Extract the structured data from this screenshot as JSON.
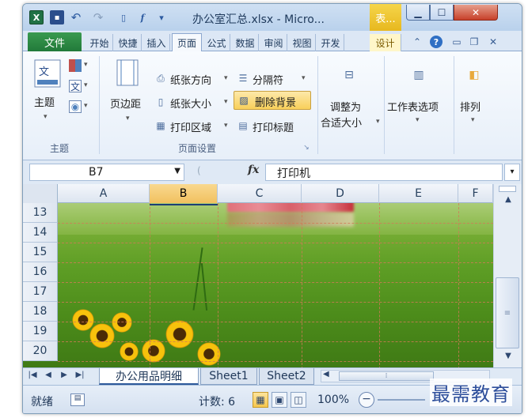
{
  "window": {
    "title": "办公室汇总.xlsx - Micro...",
    "context_tab_header": "表..."
  },
  "tabs": {
    "file": "文件",
    "items": [
      "开始",
      "快捷",
      "插入",
      "页面",
      "公式",
      "数据",
      "审阅",
      "视图",
      "开发",
      "设计"
    ],
    "active": "页面"
  },
  "ribbon": {
    "theme": {
      "label": "主题",
      "group_label": "主题"
    },
    "page_setup": {
      "margins_label": "页边距",
      "orientation_label": "纸张方向",
      "size_label": "纸张大小",
      "print_area_label": "打印区域",
      "breaks_label": "分隔符",
      "delete_bg_label": "删除背景",
      "print_titles_label": "打印标题",
      "group_label": "页面设置"
    },
    "scale": {
      "label_line1": "调整为",
      "label_line2": "合适大小"
    },
    "sheet_options": {
      "label": "工作表选项"
    },
    "arrange": {
      "label": "排列"
    }
  },
  "formula_bar": {
    "name_box": "B7",
    "fx": "fx",
    "value": "打印机"
  },
  "grid": {
    "columns": [
      "A",
      "B",
      "C",
      "D",
      "E",
      "F"
    ],
    "selected_column": "B",
    "rows": [
      "13",
      "14",
      "15",
      "16",
      "17",
      "18",
      "19",
      "20"
    ]
  },
  "sheets": {
    "tabs": [
      "办公用品明细",
      "Sheet1",
      "Sheet2"
    ],
    "active": "办公用品明细"
  },
  "status": {
    "ready": "就绪",
    "count": "计数: 6",
    "zoom": "100%"
  },
  "watermark": "最需教育",
  "colors": {
    "file_tab": "#217a3a",
    "context_tab": "#e7b81f",
    "page_break_line": "#d27a57",
    "selected_header": "#f1c15f"
  }
}
